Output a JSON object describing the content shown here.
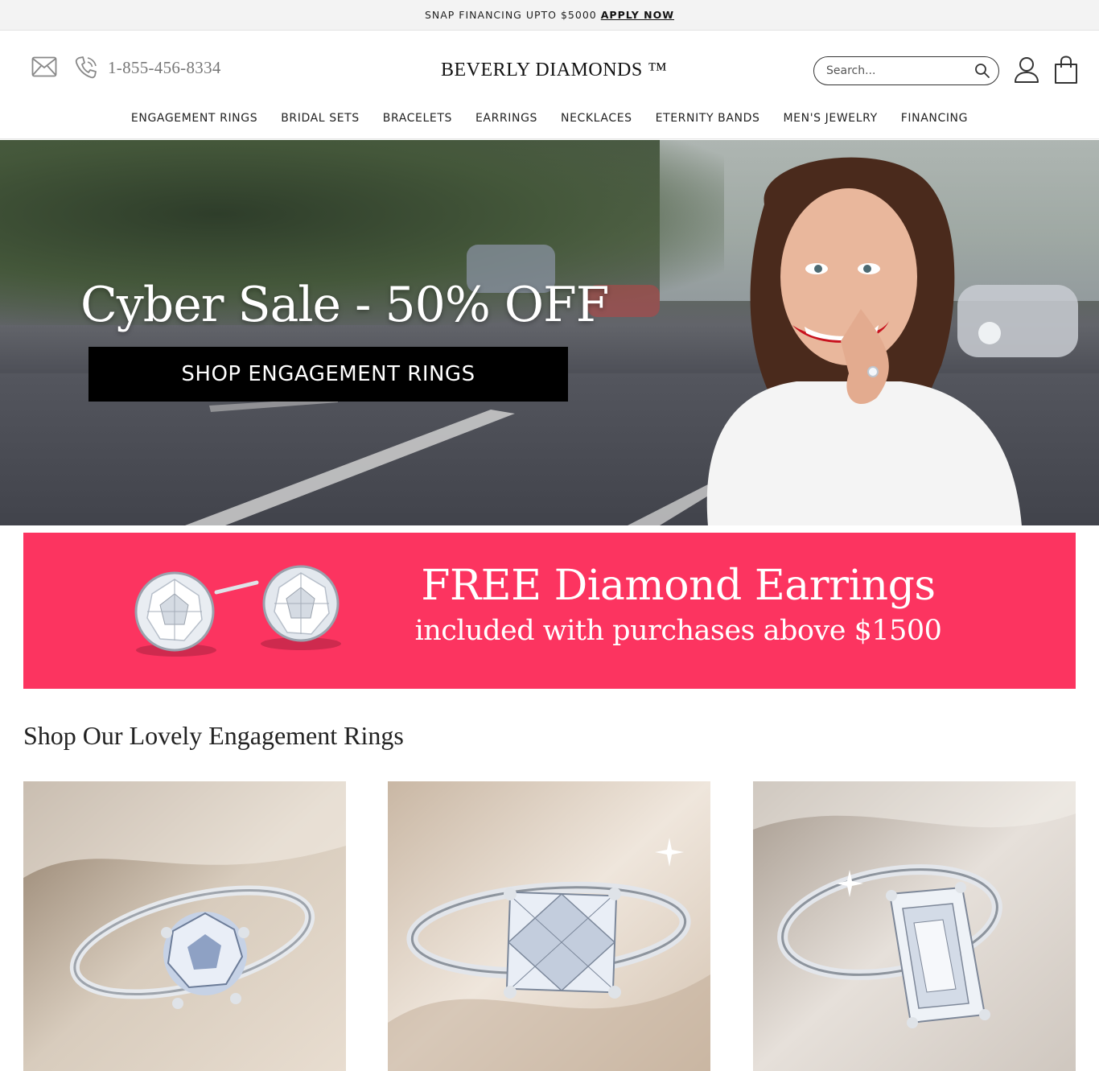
{
  "announcement": {
    "text": "SNAP FINANCING UPTO $5000",
    "link_label": "APPLY NOW"
  },
  "header": {
    "phone": "1-855-456-8334",
    "logo": "BEVERLY DIAMONDS ™",
    "search_placeholder": "Search...",
    "icons": [
      "mail-icon",
      "phone-icon",
      "search-icon",
      "user-icon",
      "cart-icon"
    ]
  },
  "nav": {
    "items": [
      "ENGAGEMENT RINGS",
      "BRIDAL SETS",
      "BRACELETS",
      "EARRINGS",
      "NECKLACES",
      "ETERNITY BANDS",
      "MEN'S JEWELRY",
      "FINANCING"
    ]
  },
  "hero": {
    "title": "Cyber Sale - 50% OFF",
    "cta": "SHOP ENGAGEMENT RINGS"
  },
  "promo": {
    "title": "FREE Diamond Earrings",
    "subtitle": "included with purchases above $1500",
    "background_color": "#fc3460"
  },
  "section": {
    "title": "Shop Our Lovely Engagement Rings",
    "products": [
      {
        "image": "round-cut-ring-image"
      },
      {
        "image": "princess-cut-ring-image"
      },
      {
        "image": "emerald-cut-ring-image"
      }
    ]
  }
}
